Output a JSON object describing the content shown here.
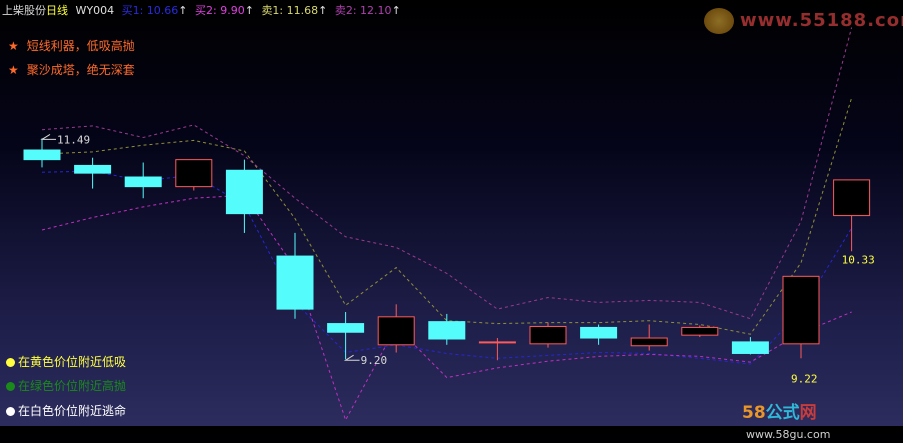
{
  "header": {
    "title": "上柴股份",
    "period": "日线",
    "indicator": "WY004",
    "buy1": "买1: 10.66",
    "buy2": "买2: 9.90",
    "sell1": "卖1: 11.68",
    "sell2": "卖2: 12.10",
    "arrow": "↑"
  },
  "notes": [
    "短线利器，低吸高抛",
    "聚沙成塔，绝无深套"
  ],
  "legend": [
    {
      "text": "在黄色价位附近低吸",
      "color": "#ffff40"
    },
    {
      "text": "在绿色价位附近高抛",
      "color": "#1a8a1a"
    },
    {
      "text": "在白色价位附近逃命",
      "color": "#ffffff"
    }
  ],
  "watermarks": {
    "top": "www.55188.com",
    "bottom_a": "58",
    "bottom_b": "公式",
    "bottom_c": "网",
    "bottom_url": "www.58gu.com"
  },
  "chart_data": {
    "type": "candlestick",
    "ylim": [
      8.58,
      12.78
    ],
    "candles": [
      {
        "o": 11.38,
        "h": 11.5,
        "l": 11.2,
        "c": 11.28
      },
      {
        "o": 11.22,
        "h": 11.3,
        "l": 10.98,
        "c": 11.14
      },
      {
        "o": 11.1,
        "h": 11.25,
        "l": 10.88,
        "c": 11.0
      },
      {
        "o": 11.0,
        "h": 11.18,
        "l": 10.96,
        "c": 11.28
      },
      {
        "o": 11.17,
        "h": 11.28,
        "l": 10.52,
        "c": 10.72
      },
      {
        "o": 10.28,
        "h": 10.52,
        "l": 9.63,
        "c": 9.73
      },
      {
        "o": 9.58,
        "h": 9.7,
        "l": 9.21,
        "c": 9.49
      },
      {
        "o": 9.36,
        "h": 9.78,
        "l": 9.28,
        "c": 9.65
      },
      {
        "o": 9.6,
        "h": 9.68,
        "l": 9.36,
        "c": 9.42
      },
      {
        "o": 9.38,
        "h": 9.43,
        "l": 9.2,
        "c": 9.39
      },
      {
        "o": 9.37,
        "h": 9.59,
        "l": 9.33,
        "c": 9.55
      },
      {
        "o": 9.54,
        "h": 9.57,
        "l": 9.36,
        "c": 9.43
      },
      {
        "o": 9.35,
        "h": 9.57,
        "l": 9.3,
        "c": 9.43
      },
      {
        "o": 9.46,
        "h": 9.56,
        "l": 9.44,
        "c": 9.54
      },
      {
        "o": 9.39,
        "h": 9.44,
        "l": 9.26,
        "c": 9.27
      },
      {
        "o": 9.37,
        "h": 9.37,
        "l": 9.22,
        "c": 10.07
      },
      {
        "o": 10.7,
        "h": 10.7,
        "l": 10.33,
        "c": 11.07
      }
    ],
    "annotations": [
      {
        "candle": 0,
        "value": 11.49,
        "label": "11.49"
      },
      {
        "candle": 6,
        "value": 9.2,
        "label": "9.20"
      },
      {
        "candle": 15,
        "value": 9.22,
        "label": "9.22"
      },
      {
        "candle": 16,
        "value": 10.33,
        "label": "10.33"
      }
    ],
    "lines": [
      {
        "name": "olive",
        "color": "#909038",
        "values": [
          11.34,
          11.36,
          11.43,
          11.48,
          11.37,
          10.67,
          9.77,
          10.16,
          9.61,
          9.58,
          9.59,
          9.59,
          9.61,
          9.57,
          9.47,
          10.21,
          11.92
        ]
      },
      {
        "name": "purple",
        "color": "#9a3a8e",
        "values": [
          11.59,
          11.63,
          11.51,
          11.64,
          11.32,
          10.88,
          10.48,
          10.37,
          10.1,
          9.73,
          9.85,
          9.8,
          9.82,
          9.8,
          9.63,
          10.64,
          12.65
        ]
      },
      {
        "name": "blue",
        "color": "#2626d8",
        "values": [
          11.15,
          11.16,
          11.06,
          11.12,
          10.81,
          9.8,
          9.28,
          9.36,
          9.27,
          9.22,
          9.25,
          9.28,
          9.27,
          9.22,
          9.16,
          9.71,
          10.57
        ]
      },
      {
        "name": "magenta",
        "color": "#c030c0",
        "values": [
          10.55,
          10.68,
          10.79,
          10.88,
          10.91,
          10.16,
          8.58,
          9.55,
          9.02,
          9.12,
          9.19,
          9.24,
          9.26,
          9.24,
          9.18,
          9.48,
          9.7
        ]
      }
    ]
  }
}
